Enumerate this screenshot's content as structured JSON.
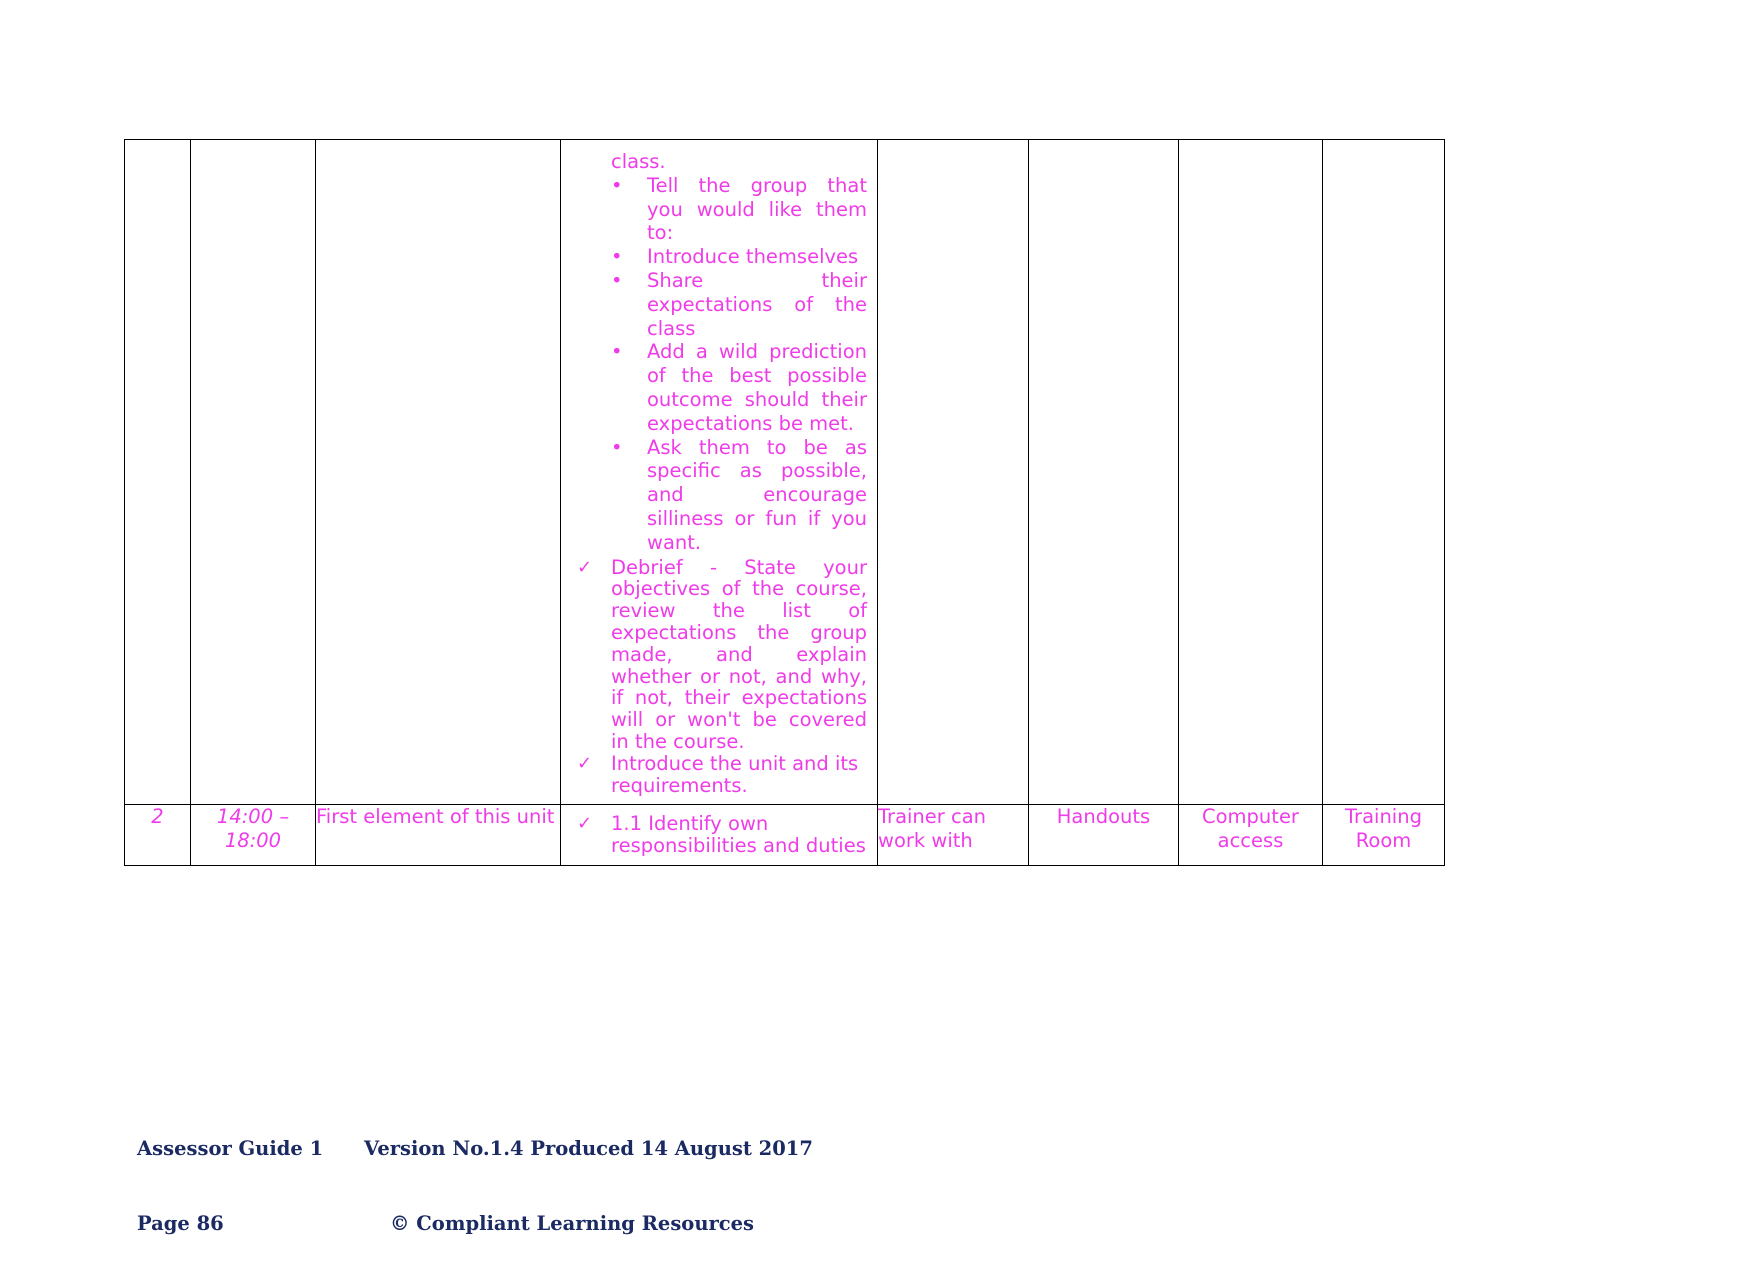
{
  "document": {
    "type": "session-plan-table",
    "text_color": "#ef3ce8",
    "footer_color": "#1b2a63",
    "border_color": "#000000"
  },
  "table": {
    "columns": [
      "session-number",
      "time",
      "element",
      "activities",
      "trainer-notes",
      "resources",
      "equipment",
      "location"
    ],
    "rows": [
      {
        "kind": "continuation",
        "number": "",
        "time": "",
        "element": "",
        "activities": {
          "lead": "class.",
          "bullets": [
            "Tell the group that you would like them to:",
            "Introduce themselves",
            "Share their expectations of the class",
            "Add a wild prediction of the best possible outcome should their expectations be met.",
            "Ask them to be as specific as possible, and encourage silliness or fun if you want."
          ],
          "checks": [
            "Debrief - State your objectives of the course, review the list of expectations the group made, and explain whether or not, and why, if not, their expectations will or won't be covered in the course.",
            "Introduce the unit and its requirements."
          ]
        },
        "trainer": "",
        "resources": "",
        "equipment": "",
        "location": ""
      },
      {
        "kind": "data",
        "number": "2",
        "time": "14:00 – 18:00",
        "element": "First element of this unit",
        "activities": {
          "lead": "",
          "bullets": [],
          "checks": [
            "1.1 Identify own responsibilities and duties"
          ]
        },
        "trainer": "Trainer can work with",
        "resources": "Handouts",
        "equipment": "Computer access",
        "location": "Training Room"
      }
    ]
  },
  "footer": {
    "left_line1": "Assessor Guide 1",
    "left_line2": "Page 86",
    "right_line1": "Version No.1.4 Produced 14 August 2017",
    "right_line2": "© Compliant Learning Resources"
  },
  "icons": {
    "bullet": "•",
    "check": "✓"
  }
}
